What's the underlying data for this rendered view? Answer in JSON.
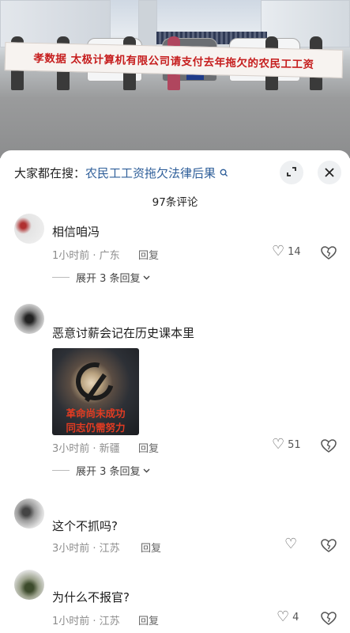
{
  "photo": {
    "banner_text": "孝数据 太极计算机有限公司请支付去年拖欠的农民工工资"
  },
  "sheet": {
    "search_prefix": "大家都在搜：",
    "search_query": "农民工工资拖欠法律后果",
    "comment_count": "97条评论"
  },
  "comments": [
    {
      "text": "相信咱冯",
      "time_location": "1小时前 · 广东",
      "reply_label": "回复",
      "likes": "14",
      "expand_label": "展开 3 条回复"
    },
    {
      "text": "恶意讨薪会记在历史课本里",
      "image_caption_line1": "革命尚未成功",
      "image_caption_line2": "同志仍需努力",
      "time_location": "3小时前 · 新疆",
      "reply_label": "回复",
      "likes": "51",
      "expand_label": "展开 3 条回复"
    },
    {
      "text": "这个不抓吗?",
      "time_location": "3小时前 · 江苏",
      "reply_label": "回复",
      "likes": ""
    },
    {
      "text": "为什么不报官?",
      "time_location": "1小时前 · 江苏",
      "reply_label": "回复",
      "likes": "4"
    }
  ],
  "icons": {
    "expand_sheet": "expand-icon",
    "close": "close-icon",
    "search": "search-icon",
    "like": "heart-icon",
    "dislike": "broken-heart-icon",
    "chevron": "chevron-down-icon"
  },
  "colors": {
    "banner_text": "#c61e1e",
    "search_link": "#2f5f9a",
    "caption": "#e23b22"
  }
}
